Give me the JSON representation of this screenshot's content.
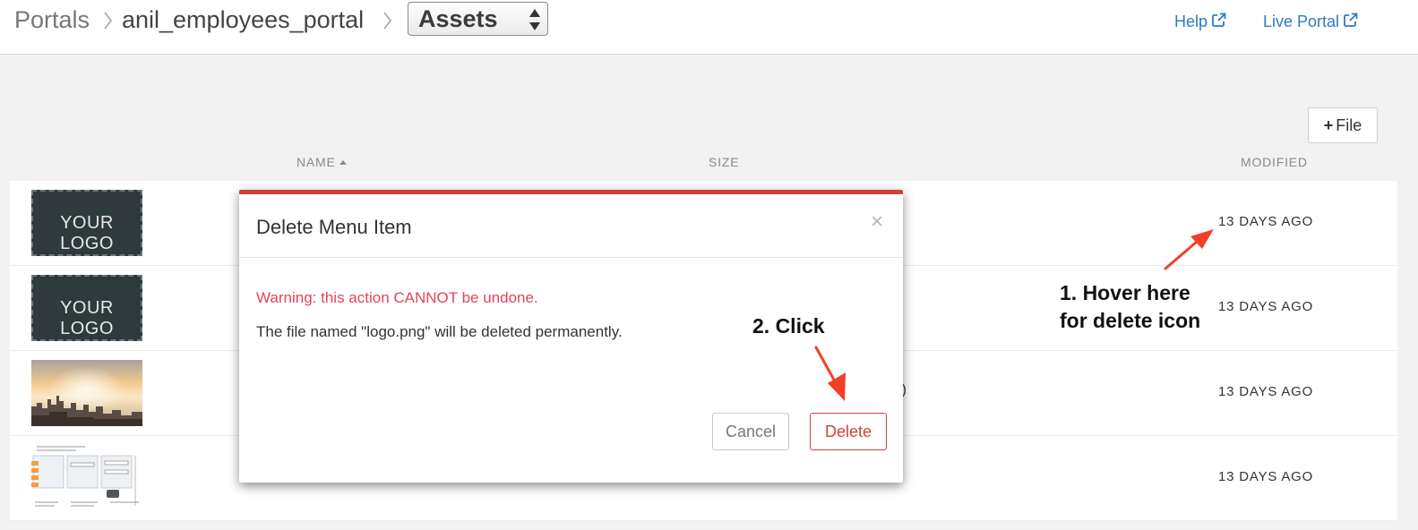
{
  "breadcrumb": {
    "root": "Portals",
    "portal": "anil_employees_portal",
    "section_selected": "Assets"
  },
  "header_links": {
    "help": "Help",
    "live_portal": "Live Portal"
  },
  "toolbar": {
    "add_file_label": "File"
  },
  "table": {
    "columns": {
      "name": "NAME",
      "size": "SIZE",
      "modified": "MODIFIED"
    },
    "rows": [
      {
        "thumbnail": "YOUR LOGO",
        "modified": "13 DAYS AGO"
      },
      {
        "thumbnail": "YOUR LOGO",
        "modified": "13 DAYS AGO"
      },
      {
        "thumbnail": "city-skyline-image",
        "size_fragment": "B)",
        "modified": "13 DAYS AGO"
      },
      {
        "thumbnail": "diagram-image",
        "modified": "13 DAYS AGO"
      }
    ]
  },
  "dialog": {
    "title": "Delete Menu Item",
    "close": "×",
    "warning": "Warning: this action CANNOT be undone.",
    "message": "The file named \"logo.png\" will be deleted permanently.",
    "cancel_label": "Cancel",
    "delete_label": "Delete"
  },
  "annotations": {
    "click": "2. Click",
    "hover_line1": "1. Hover here",
    "hover_line2": "for delete icon"
  },
  "colors": {
    "accent_red": "#d0413a",
    "warning_pink": "#e0455b",
    "link_blue": "#2c7bc0",
    "annotation_arrow": "#f0402a"
  },
  "icons": {
    "breadcrumb_separator": "chevron-right-icon",
    "select_arrows": "up-down-arrows-icon",
    "external_link": "external-link-icon",
    "add": "plus-icon",
    "sort": "sort-ascending-icon",
    "close": "close-icon"
  }
}
